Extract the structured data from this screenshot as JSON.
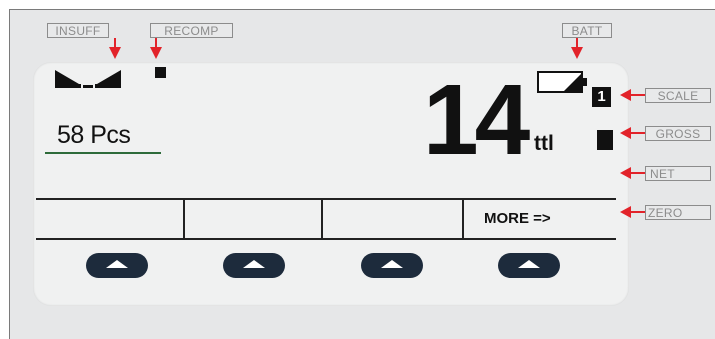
{
  "labels": {
    "insuff": "INSUFF",
    "recomp": "RECOMP",
    "batt": "BATT",
    "scale": "SCALE",
    "gross": "GROSS",
    "net": "NET",
    "zero": "ZERO"
  },
  "display": {
    "count_text": "58 Pcs",
    "main_value": "14",
    "unit": "ttl",
    "scale_number": "1"
  },
  "softkeys": {
    "key4_label": "MORE =>"
  },
  "colors": {
    "panel": "#e6e7e8",
    "lcd": "#f0f1f1",
    "arrow": "#e2232a",
    "softkey": "#1d2b3c",
    "underline": "#2e6b3a"
  }
}
